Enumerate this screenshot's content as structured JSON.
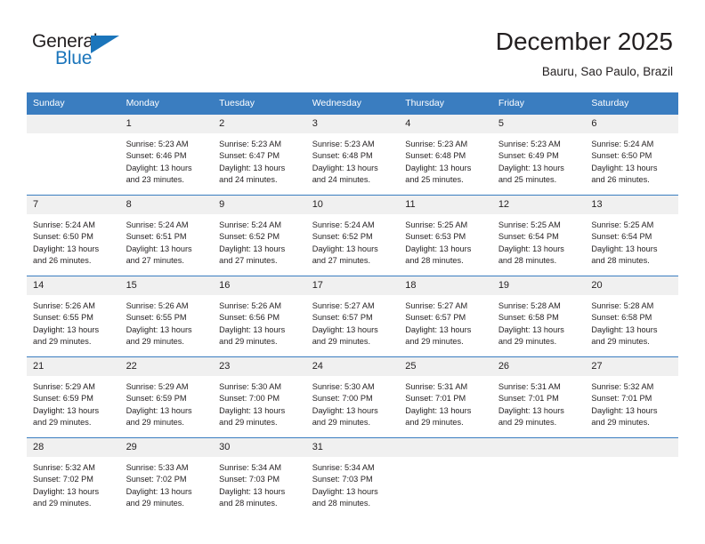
{
  "logo": {
    "word1": "General",
    "word2": "Blue",
    "triangle_color": "#1b75bb",
    "text_color": "#231f20"
  },
  "header": {
    "title": "December 2025",
    "subtitle": "Bauru, Sao Paulo, Brazil"
  },
  "colors": {
    "header_blue": "#3a7dc0",
    "daynum_gray": "#f0f0f0",
    "text": "#231f20"
  },
  "weekday_headers": [
    "Sunday",
    "Monday",
    "Tuesday",
    "Wednesday",
    "Thursday",
    "Friday",
    "Saturday"
  ],
  "weeks": [
    [
      {
        "day": "",
        "sunrise": "",
        "sunset": "",
        "daylight1": "",
        "daylight2": ""
      },
      {
        "day": "1",
        "sunrise": "Sunrise: 5:23 AM",
        "sunset": "Sunset: 6:46 PM",
        "daylight1": "Daylight: 13 hours",
        "daylight2": "and 23 minutes."
      },
      {
        "day": "2",
        "sunrise": "Sunrise: 5:23 AM",
        "sunset": "Sunset: 6:47 PM",
        "daylight1": "Daylight: 13 hours",
        "daylight2": "and 24 minutes."
      },
      {
        "day": "3",
        "sunrise": "Sunrise: 5:23 AM",
        "sunset": "Sunset: 6:48 PM",
        "daylight1": "Daylight: 13 hours",
        "daylight2": "and 24 minutes."
      },
      {
        "day": "4",
        "sunrise": "Sunrise: 5:23 AM",
        "sunset": "Sunset: 6:48 PM",
        "daylight1": "Daylight: 13 hours",
        "daylight2": "and 25 minutes."
      },
      {
        "day": "5",
        "sunrise": "Sunrise: 5:23 AM",
        "sunset": "Sunset: 6:49 PM",
        "daylight1": "Daylight: 13 hours",
        "daylight2": "and 25 minutes."
      },
      {
        "day": "6",
        "sunrise": "Sunrise: 5:24 AM",
        "sunset": "Sunset: 6:50 PM",
        "daylight1": "Daylight: 13 hours",
        "daylight2": "and 26 minutes."
      }
    ],
    [
      {
        "day": "7",
        "sunrise": "Sunrise: 5:24 AM",
        "sunset": "Sunset: 6:50 PM",
        "daylight1": "Daylight: 13 hours",
        "daylight2": "and 26 minutes."
      },
      {
        "day": "8",
        "sunrise": "Sunrise: 5:24 AM",
        "sunset": "Sunset: 6:51 PM",
        "daylight1": "Daylight: 13 hours",
        "daylight2": "and 27 minutes."
      },
      {
        "day": "9",
        "sunrise": "Sunrise: 5:24 AM",
        "sunset": "Sunset: 6:52 PM",
        "daylight1": "Daylight: 13 hours",
        "daylight2": "and 27 minutes."
      },
      {
        "day": "10",
        "sunrise": "Sunrise: 5:24 AM",
        "sunset": "Sunset: 6:52 PM",
        "daylight1": "Daylight: 13 hours",
        "daylight2": "and 27 minutes."
      },
      {
        "day": "11",
        "sunrise": "Sunrise: 5:25 AM",
        "sunset": "Sunset: 6:53 PM",
        "daylight1": "Daylight: 13 hours",
        "daylight2": "and 28 minutes."
      },
      {
        "day": "12",
        "sunrise": "Sunrise: 5:25 AM",
        "sunset": "Sunset: 6:54 PM",
        "daylight1": "Daylight: 13 hours",
        "daylight2": "and 28 minutes."
      },
      {
        "day": "13",
        "sunrise": "Sunrise: 5:25 AM",
        "sunset": "Sunset: 6:54 PM",
        "daylight1": "Daylight: 13 hours",
        "daylight2": "and 28 minutes."
      }
    ],
    [
      {
        "day": "14",
        "sunrise": "Sunrise: 5:26 AM",
        "sunset": "Sunset: 6:55 PM",
        "daylight1": "Daylight: 13 hours",
        "daylight2": "and 29 minutes."
      },
      {
        "day": "15",
        "sunrise": "Sunrise: 5:26 AM",
        "sunset": "Sunset: 6:55 PM",
        "daylight1": "Daylight: 13 hours",
        "daylight2": "and 29 minutes."
      },
      {
        "day": "16",
        "sunrise": "Sunrise: 5:26 AM",
        "sunset": "Sunset: 6:56 PM",
        "daylight1": "Daylight: 13 hours",
        "daylight2": "and 29 minutes."
      },
      {
        "day": "17",
        "sunrise": "Sunrise: 5:27 AM",
        "sunset": "Sunset: 6:57 PM",
        "daylight1": "Daylight: 13 hours",
        "daylight2": "and 29 minutes."
      },
      {
        "day": "18",
        "sunrise": "Sunrise: 5:27 AM",
        "sunset": "Sunset: 6:57 PM",
        "daylight1": "Daylight: 13 hours",
        "daylight2": "and 29 minutes."
      },
      {
        "day": "19",
        "sunrise": "Sunrise: 5:28 AM",
        "sunset": "Sunset: 6:58 PM",
        "daylight1": "Daylight: 13 hours",
        "daylight2": "and 29 minutes."
      },
      {
        "day": "20",
        "sunrise": "Sunrise: 5:28 AM",
        "sunset": "Sunset: 6:58 PM",
        "daylight1": "Daylight: 13 hours",
        "daylight2": "and 29 minutes."
      }
    ],
    [
      {
        "day": "21",
        "sunrise": "Sunrise: 5:29 AM",
        "sunset": "Sunset: 6:59 PM",
        "daylight1": "Daylight: 13 hours",
        "daylight2": "and 29 minutes."
      },
      {
        "day": "22",
        "sunrise": "Sunrise: 5:29 AM",
        "sunset": "Sunset: 6:59 PM",
        "daylight1": "Daylight: 13 hours",
        "daylight2": "and 29 minutes."
      },
      {
        "day": "23",
        "sunrise": "Sunrise: 5:30 AM",
        "sunset": "Sunset: 7:00 PM",
        "daylight1": "Daylight: 13 hours",
        "daylight2": "and 29 minutes."
      },
      {
        "day": "24",
        "sunrise": "Sunrise: 5:30 AM",
        "sunset": "Sunset: 7:00 PM",
        "daylight1": "Daylight: 13 hours",
        "daylight2": "and 29 minutes."
      },
      {
        "day": "25",
        "sunrise": "Sunrise: 5:31 AM",
        "sunset": "Sunset: 7:01 PM",
        "daylight1": "Daylight: 13 hours",
        "daylight2": "and 29 minutes."
      },
      {
        "day": "26",
        "sunrise": "Sunrise: 5:31 AM",
        "sunset": "Sunset: 7:01 PM",
        "daylight1": "Daylight: 13 hours",
        "daylight2": "and 29 minutes."
      },
      {
        "day": "27",
        "sunrise": "Sunrise: 5:32 AM",
        "sunset": "Sunset: 7:01 PM",
        "daylight1": "Daylight: 13 hours",
        "daylight2": "and 29 minutes."
      }
    ],
    [
      {
        "day": "28",
        "sunrise": "Sunrise: 5:32 AM",
        "sunset": "Sunset: 7:02 PM",
        "daylight1": "Daylight: 13 hours",
        "daylight2": "and 29 minutes."
      },
      {
        "day": "29",
        "sunrise": "Sunrise: 5:33 AM",
        "sunset": "Sunset: 7:02 PM",
        "daylight1": "Daylight: 13 hours",
        "daylight2": "and 29 minutes."
      },
      {
        "day": "30",
        "sunrise": "Sunrise: 5:34 AM",
        "sunset": "Sunset: 7:03 PM",
        "daylight1": "Daylight: 13 hours",
        "daylight2": "and 28 minutes."
      },
      {
        "day": "31",
        "sunrise": "Sunrise: 5:34 AM",
        "sunset": "Sunset: 7:03 PM",
        "daylight1": "Daylight: 13 hours",
        "daylight2": "and 28 minutes."
      },
      {
        "day": "",
        "sunrise": "",
        "sunset": "",
        "daylight1": "",
        "daylight2": ""
      },
      {
        "day": "",
        "sunrise": "",
        "sunset": "",
        "daylight1": "",
        "daylight2": ""
      },
      {
        "day": "",
        "sunrise": "",
        "sunset": "",
        "daylight1": "",
        "daylight2": ""
      }
    ]
  ]
}
